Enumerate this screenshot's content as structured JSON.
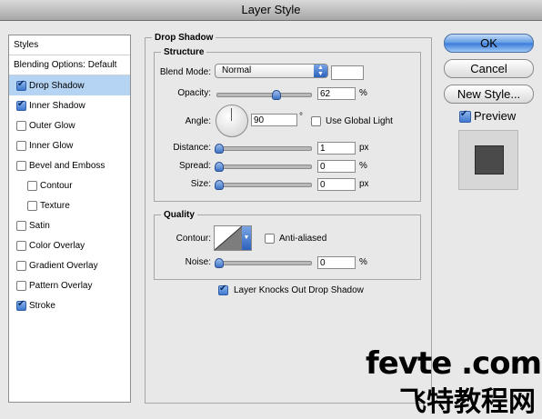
{
  "window": {
    "title": "Layer Style"
  },
  "styles_list": {
    "header": "Styles",
    "blending": "Blending Options: Default",
    "items": [
      {
        "label": "Drop Shadow",
        "checked": true,
        "selected": true,
        "indent": false
      },
      {
        "label": "Inner Shadow",
        "checked": true,
        "selected": false,
        "indent": false
      },
      {
        "label": "Outer Glow",
        "checked": false,
        "selected": false,
        "indent": false
      },
      {
        "label": "Inner Glow",
        "checked": false,
        "selected": false,
        "indent": false
      },
      {
        "label": "Bevel and Emboss",
        "checked": false,
        "selected": false,
        "indent": false
      },
      {
        "label": "Contour",
        "checked": false,
        "selected": false,
        "indent": true
      },
      {
        "label": "Texture",
        "checked": false,
        "selected": false,
        "indent": true
      },
      {
        "label": "Satin",
        "checked": false,
        "selected": false,
        "indent": false
      },
      {
        "label": "Color Overlay",
        "checked": false,
        "selected": false,
        "indent": false
      },
      {
        "label": "Gradient Overlay",
        "checked": false,
        "selected": false,
        "indent": false
      },
      {
        "label": "Pattern Overlay",
        "checked": false,
        "selected": false,
        "indent": false
      },
      {
        "label": "Stroke",
        "checked": true,
        "selected": false,
        "indent": false
      }
    ]
  },
  "panel": {
    "title": "Drop Shadow",
    "structure": {
      "title": "Structure",
      "blend_mode_label": "Blend Mode:",
      "blend_mode_value": "Normal",
      "opacity_label": "Opacity:",
      "opacity_value": "62",
      "opacity_unit": "%",
      "opacity_level": 0.62,
      "angle_label": "Angle:",
      "angle_value": "90",
      "angle_unit": "°",
      "global_light_label": "Use Global Light",
      "global_light_checked": false,
      "distance_label": "Distance:",
      "distance_value": "1",
      "distance_unit": "px",
      "spread_label": "Spread:",
      "spread_value": "0",
      "spread_unit": "%",
      "size_label": "Size:",
      "size_value": "0",
      "size_unit": "px"
    },
    "quality": {
      "title": "Quality",
      "contour_label": "Contour:",
      "antialiased_label": "Anti-aliased",
      "antialiased_checked": false,
      "noise_label": "Noise:",
      "noise_value": "0",
      "noise_unit": "%"
    },
    "knockout_label": "Layer Knocks Out Drop Shadow",
    "knockout_checked": true
  },
  "buttons": {
    "ok": "OK",
    "reset": "Cancel",
    "new_style": "New Style...",
    "preview_label": "Preview",
    "preview_checked": true
  },
  "watermark": {
    "line1": "fevte .com",
    "line2": "飞特教程网"
  },
  "colors": {
    "accent": "#3a7ad9",
    "selection": "#b5d3f3"
  }
}
